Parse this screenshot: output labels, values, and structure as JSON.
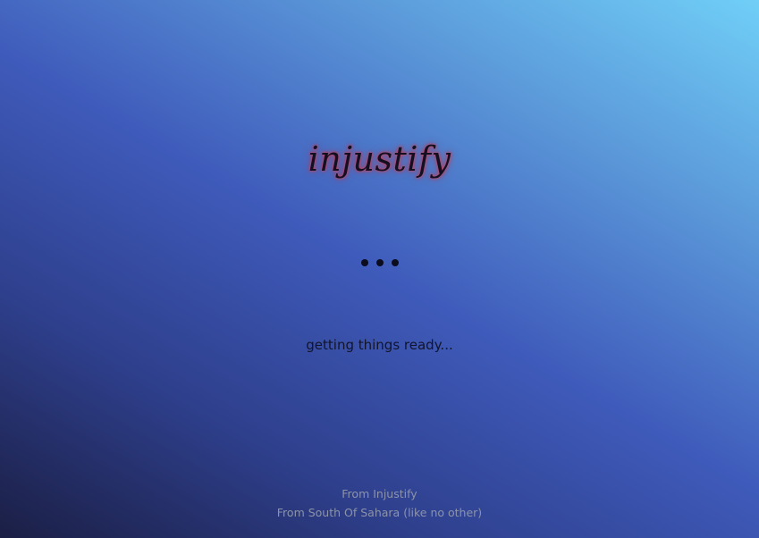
{
  "app": {
    "logo_text": "injustify"
  },
  "loader": {
    "status_text": "getting things ready..."
  },
  "footer": {
    "line1": "From Injustify",
    "line2": "From South Of Sahara (like no other)"
  },
  "colors": {
    "gradient_dark": "#1b1f45",
    "gradient_mid": "#3f5bbb",
    "gradient_light": "#70cff7",
    "logo_text": "#130f22",
    "logo_glow": "#d8485f",
    "dots": "#0b0d1e",
    "footer_text": "#8c93a9"
  },
  "icons": [
    "loading-dots-icon"
  ]
}
